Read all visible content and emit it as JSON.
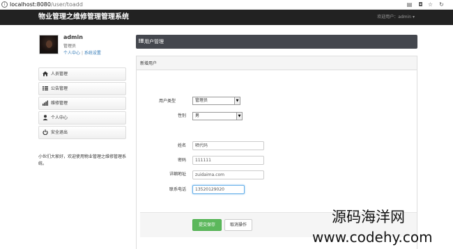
{
  "browser": {
    "url_host": "localhost:8080",
    "url_path": "/user/toadd"
  },
  "navbar": {
    "brand": "物业管理之维修管理管理系统",
    "user_menu": "欢迎用户：admin ▾"
  },
  "profile": {
    "name": "admin",
    "role": "管理员",
    "link_personal": "个人中心",
    "link_separator": "|",
    "link_settings": "系统设置"
  },
  "sidebar": {
    "items": [
      {
        "label": "人员管理",
        "icon": "home-icon"
      },
      {
        "label": "公告管理",
        "icon": "list-icon"
      },
      {
        "label": "维修管理",
        "icon": "bar-chart-icon"
      },
      {
        "label": "个人中心",
        "icon": "user-icon"
      },
      {
        "label": "安全退出",
        "icon": "power-icon"
      }
    ],
    "note": "小伙们大家好，欢迎使用物业管理之维修管理系统。"
  },
  "main": {
    "panel_title": "用户管理",
    "form_title": "新增用户",
    "fields": {
      "user_type": {
        "label": "用户类型",
        "value": "管理员"
      },
      "gender": {
        "label": "性别",
        "value": "男"
      },
      "name": {
        "label": "姓名",
        "value": "晒代码"
      },
      "password": {
        "label": "密码",
        "value": "111111"
      },
      "address": {
        "label": "详细地址",
        "value": "zuidaima.com"
      },
      "phone": {
        "label": "联系电话",
        "value": "13520129020"
      }
    },
    "submit_label": "提交保存",
    "cancel_label": "取消操作"
  },
  "watermark": {
    "line1": "源码海洋网",
    "line2": "www.codehy.com"
  }
}
